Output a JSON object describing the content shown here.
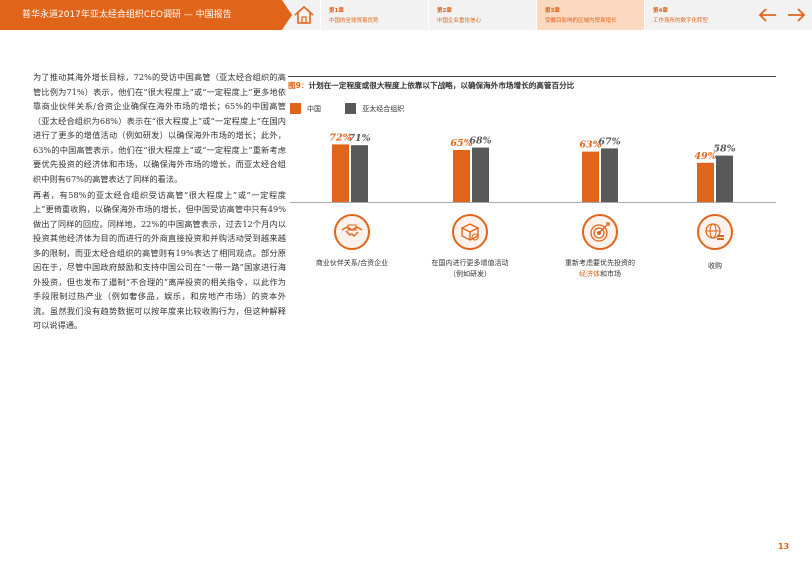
{
  "header": {
    "title": "普华永道2017年亚太经合组织CEO调研 — 中国报告",
    "tabs": [
      {
        "chapter": "第1章",
        "label": "中国的全球贸易优势"
      },
      {
        "chapter": "第2章",
        "label": "中国企业重拾信心"
      },
      {
        "chapter": "第3章",
        "label": "受瞩目影响的区域内贸易增长"
      },
      {
        "chapter": "第4章",
        "label": "工作场所的数字化转型"
      }
    ],
    "active_tab": 2,
    "accent": "#e0651b"
  },
  "body": {
    "para1": "为了推动其海外增长目标，72%的受访中国高管（亚太经合组织的高管比例为71%）表示，他们在“很大程度上”或“一定程度上”更多地依靠商业伙伴关系/合资企业确保在海外市场的增长；65%的中国高管（亚太经合组织为68%）表示在“很大程度上”或“一定程度上”在国内进行了更多的增值活动（例如研发）以确保海外市场的增长；此外，63%的中国高管表示，他们在“很大程度上”或“一定程度上”重新考虑要优先投资的经济体和市场，以确保海外市场的增长，而亚太经合组织中则有67%的高管表达了同样的看法。",
    "para2": "再者，有58%的亚太经合组织受访高管“很大程度上”或“一定程度上”更倚重收购，以确保海外市场的增长，但中国受访高管中只有49%做出了同样的回应。同样地，22%的中国高管表示，过去12个月内以投资其他经济体为目的而进行的外商直接投资和并购活动受到越来越多的限制，而亚太经合组织的高管则有19%表达了相同观点。部分原因在于，尽管中国政府鼓励和支持中国公司在“一带一路”国家进行海外投资，但也发布了遏制“不合理的”离岸投资的相关指令，以此作为手段限制过热产业（例如奢侈品，娱乐，和房地产市场）的资本外流。虽然我们没有趋势数据可以按年度来比较收购行为，但这种解释可以说得通。"
  },
  "figure": {
    "number": "图9：",
    "title": "计划在一定程度或很大程度上依靠以下战略，以确保海外市场增长的高管百分比",
    "captions": [
      {
        "pre": "商业伙伴关系/合资企业",
        "hl": "",
        "post": "",
        "line2": ""
      },
      {
        "pre": "在国内进行更多增值活动",
        "hl": "",
        "post": "",
        "line2": "（例如研发）"
      },
      {
        "pre": "重新考虑要优先投资的",
        "hl": "经济体",
        "post": "和市场",
        "line2": ""
      },
      {
        "pre": "收购",
        "hl": "",
        "post": "",
        "line2": ""
      }
    ],
    "icons": [
      "handshake-icon",
      "box-icon",
      "target-icon",
      "globe-coins-icon"
    ]
  },
  "chart_data": {
    "type": "bar",
    "categories": [
      "商业伙伴关系/合资企业",
      "在国内进行更多增值活动（例如研发）",
      "重新考虑要优先投资的经济体和市场",
      "收购"
    ],
    "series": [
      {
        "name": "中国",
        "values": [
          72,
          65,
          63,
          49
        ],
        "color": "#e0651b"
      },
      {
        "name": "亚太经合组织",
        "values": [
          71,
          68,
          67,
          58
        ],
        "color": "#595959"
      }
    ],
    "value_suffix": "%",
    "ylim": [
      0,
      100
    ],
    "legend_position": "top-left",
    "grid": false
  },
  "page_number": "13"
}
